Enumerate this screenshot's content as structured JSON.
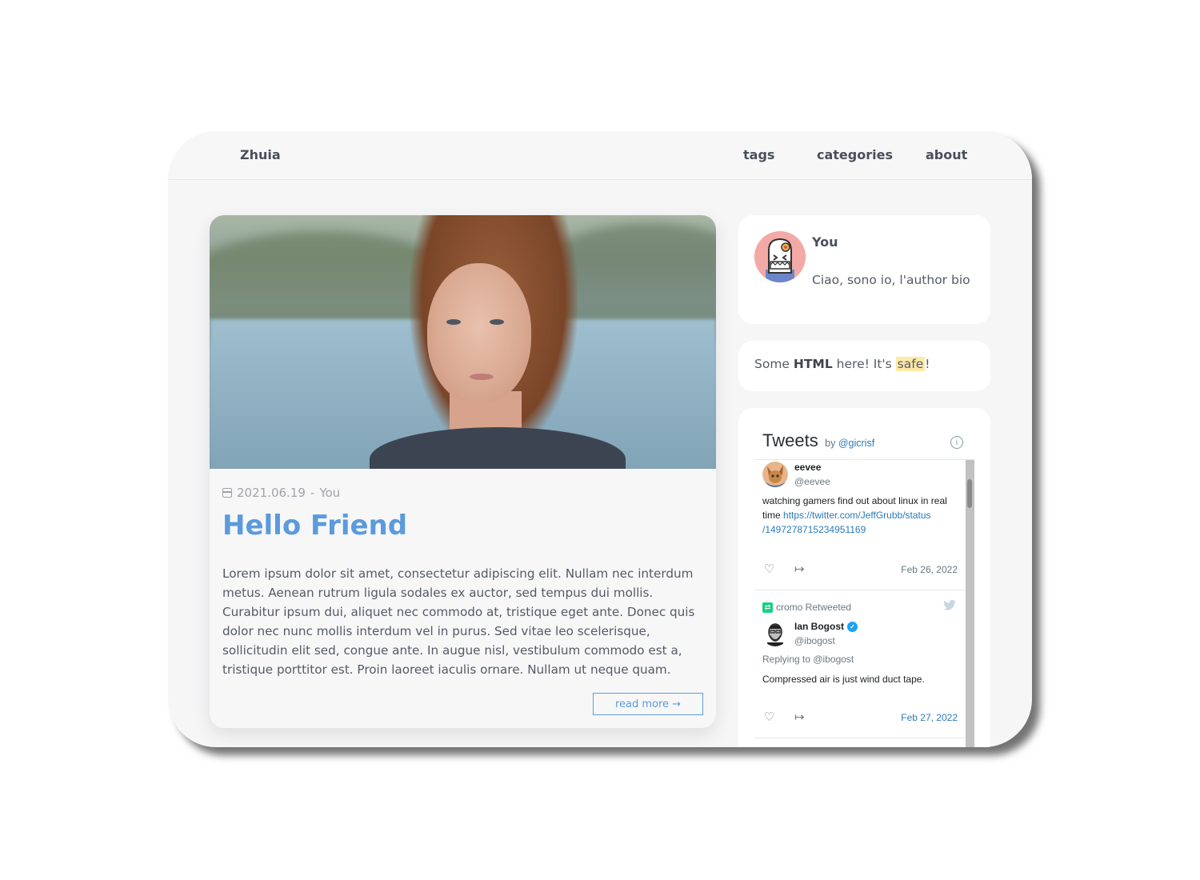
{
  "nav": {
    "brand": "Zhuia",
    "links": [
      {
        "label": "tags"
      },
      {
        "label": "categories"
      },
      {
        "label": "about"
      }
    ]
  },
  "post": {
    "image_alt": "portrait of a woman with auburn bob haircut by a lake",
    "icon": "calendar-icon",
    "date": "2021.06.19",
    "separator": "-",
    "author": "You",
    "title": "Hello Friend",
    "body": "Lorem ipsum dolor sit amet, consectetur adipiscing elit. Nullam nec interdum metus. Aenean rutrum ligula sodales ex auctor, sed tempus dui mollis. Curabitur ipsum dui, aliquet nec commodo at, tristique eget ante. Donec quis dolor nec nunc mollis interdum vel in purus. Sed vitae leo scelerisque, sollicitudin elit sed, congue ante. In augue nisl, vestibulum commodo est a, tristique porttitor est. Proin laoreet iaculis ornare. Nullam ut neque quam.",
    "read_more": "read more →"
  },
  "author_card": {
    "name": "You",
    "bio": "Ciao, sono io, l'author bio"
  },
  "html_card": {
    "prefix": "Some ",
    "bold": "HTML",
    "middle": " here! It's ",
    "highlight": "safe",
    "suffix": "!"
  },
  "tweets": {
    "title": "Tweets",
    "by_label": "by",
    "by_handle": "@gicrisf",
    "info_icon": "i",
    "items": [
      {
        "name": "eevee",
        "handle": "@eevee",
        "text": "watching gamers find out about linux in real time ",
        "link": "https://twitter.com/JeffGrubb/status/1497278715234951169",
        "link_display_1": "https://twitter.com/JeffGrubb/status",
        "link_display_2": "/1497278715234951169",
        "date": "Feb 26, 2022"
      },
      {
        "retweeted_by": "cromo Retweeted",
        "name": "Ian Bogost",
        "verified": true,
        "handle": "@ibogost",
        "replying_to": "Replying to @ibogost",
        "text": "Compressed air is just wind duct tape.",
        "date": "Feb 27, 2022"
      }
    ],
    "icons": {
      "like": "♡",
      "share": "↦",
      "bird": "🐦"
    }
  },
  "colors": {
    "accent": "#5b9bdc",
    "text": "#555a66",
    "highlight": "#fde9a6",
    "twitter_link": "#2b7bb9",
    "retweet_green": "#19cf86"
  }
}
